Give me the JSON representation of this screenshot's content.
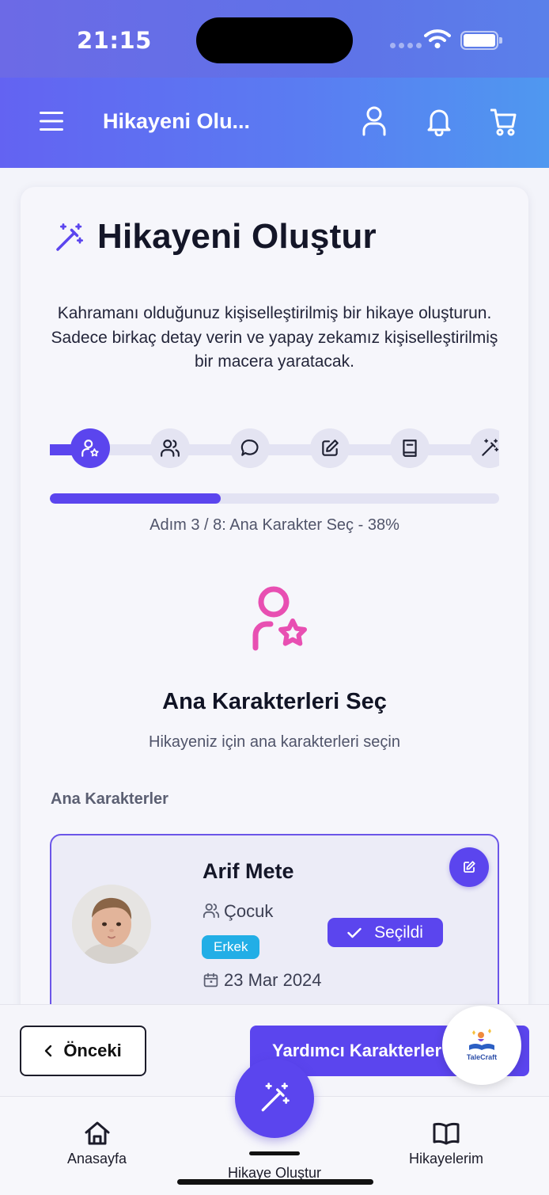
{
  "status_bar": {
    "time": "21:15"
  },
  "header": {
    "title": "Hikayeni Olu..."
  },
  "card": {
    "title": "Hikayeni Oluştur",
    "description": "Kahramanı olduğunuz kişiselleştirilmiş bir hikaye oluşturun. Sadece birkaç detay verin ve yapay zekamız kişiselleştirilmiş bir macera yaratacak."
  },
  "stepper": {
    "steps": [
      {
        "icon": "user-star-icon",
        "active": true
      },
      {
        "icon": "users-icon",
        "active": false
      },
      {
        "icon": "chat-bubble-icon",
        "active": false
      },
      {
        "icon": "pencil-square-icon",
        "active": false
      },
      {
        "icon": "book-icon",
        "active": false
      },
      {
        "icon": "magic-wand-icon",
        "active": false
      }
    ]
  },
  "progress": {
    "percent": 38,
    "text": "Adım 3 / 8: Ana Karakter Seç - 38%"
  },
  "section": {
    "title": "Ana Karakterleri Seç",
    "subtitle": "Hikayeniz için ana karakterleri seçin",
    "list_label": "Ana Karakterler"
  },
  "character": {
    "name": "Arif Mete",
    "role": "Çocuk",
    "gender": "Erkek",
    "date": "23 Mar 2024",
    "selected_label": "Seçildi"
  },
  "footer": {
    "prev_label": "Önceki",
    "next_label": "Yardımcı Karakterler"
  },
  "logo": {
    "text": "TaleCraft"
  },
  "bottom_nav": {
    "home": "Anasayfa",
    "create": "Hikaye Oluştur",
    "stories": "Hikayelerim"
  },
  "colors": {
    "primary": "#5b45ee",
    "accent_pink": "#e84fb2",
    "badge_blue": "#22aee6"
  }
}
